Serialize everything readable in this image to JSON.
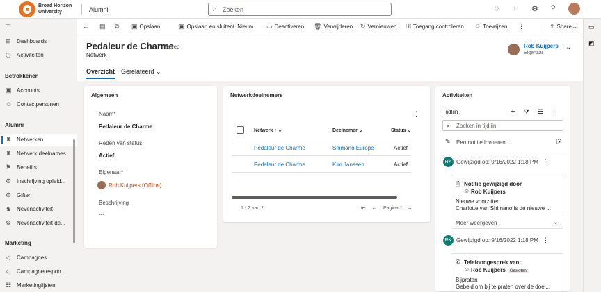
{
  "topbar": {
    "org_line1": "Broad Horizon",
    "org_line2": "University",
    "app_name": "Alumni",
    "search_placeholder": "Zoeken"
  },
  "sidebar": {
    "items_top": [
      {
        "label": "Dashboards",
        "icon": "dashboard-icon"
      },
      {
        "label": "Activiteiten",
        "icon": "activities-icon"
      }
    ],
    "section1": "Betrokkenen",
    "items_s1": [
      {
        "label": "Accounts",
        "icon": "account-icon"
      },
      {
        "label": "Contactpersonen",
        "icon": "contact-icon"
      }
    ],
    "section2": "Alumni",
    "items_s2": [
      {
        "label": "Netwerken",
        "icon": "network-icon",
        "active": true
      },
      {
        "label": "Netwerk deelnames",
        "icon": "network-members-icon"
      },
      {
        "label": "Benefits",
        "icon": "benefits-icon"
      },
      {
        "label": "Inschrijving opleid...",
        "icon": "enrollment-icon"
      },
      {
        "label": "Giften",
        "icon": "gift-icon"
      },
      {
        "label": "Nevenactiviteit",
        "icon": "side-activity-icon"
      },
      {
        "label": "Nevenactiviteit de...",
        "icon": "side-activity-detail-icon"
      }
    ],
    "section3": "Marketing",
    "items_s3": [
      {
        "label": "Campagnes",
        "icon": "campaign-icon"
      },
      {
        "label": "Campagnerespon...",
        "icon": "campaign-response-icon"
      },
      {
        "label": "Marketinglijsten",
        "icon": "marketing-list-icon"
      }
    ]
  },
  "commandbar": {
    "save": "Opslaan",
    "save_close": "Opslaan en sluiten",
    "new": "Nieuw",
    "deactivate": "Deactiveren",
    "delete": "Verwijderen",
    "refresh": "Vernieuwen",
    "check_access": "Toegang controleren",
    "assign": "Toewijzen",
    "share": "Share"
  },
  "record": {
    "title": "Pedaleur de Charme",
    "saved": "- Saved",
    "entity": "Netwerk",
    "owner_name": "Rob Kuijpers",
    "owner_role": "Eigenaar"
  },
  "tabs": {
    "overview": "Overzicht",
    "related": "Gerelateerd"
  },
  "general": {
    "title": "Algemeen",
    "name_label": "Naam*",
    "name_value": "Pedaleur de Charme",
    "status_label": "Reden van status",
    "status_value": "Actief",
    "owner_label": "Eigenaar*",
    "owner_value": "Rob Kuijpers (Offline)",
    "desc_label": "Beschrijving",
    "desc_value": "---"
  },
  "members": {
    "title": "Netwerkdeelnemers",
    "col_network": "Netwerk",
    "col_member": "Deelnemer",
    "col_status": "Status",
    "rows": [
      {
        "network": "Pedaleur de Charme",
        "member": "Shimano Europe",
        "status": "Actief"
      },
      {
        "network": "Pedaleur de Charme",
        "member": "Kim Janssen",
        "status": "Actief"
      }
    ],
    "count": "1 - 2 van 2",
    "page": "Pagina 1"
  },
  "activities": {
    "title": "Activiteiten",
    "timeline": "Tijdlijn",
    "search_placeholder": "Zoeken in tijdlijn",
    "note_placeholder": "Een notitie invoeren...",
    "entries": [
      {
        "initials": "RK",
        "modified": "Gewijzigd op: 9/16/2022 1:18 PM",
        "type": "Notitie gewijzigd door",
        "by": "Rob Kuijpers",
        "line1": "Nieuwe voorzitter",
        "line2": "Charlotte van Shimano is de nieuwe ...",
        "more": "Meer weergeven"
      },
      {
        "initials": "RK",
        "modified": "Gewijzigd op: 9/16/2022 1:18 PM",
        "type": "Telefoongesprek van:",
        "by": "Rob Kuijpers",
        "tag": "Gesloten",
        "line1": "Bijpraten",
        "line2": "Gebeld om bij te praten over de doel..."
      }
    ]
  }
}
